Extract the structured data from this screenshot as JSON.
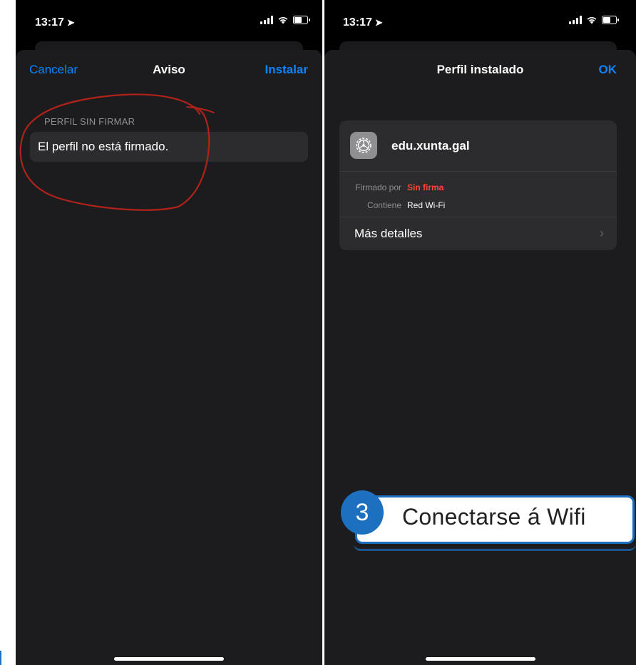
{
  "left_screen": {
    "status": {
      "time": "13:17"
    },
    "nav": {
      "left": "Cancelar",
      "title": "Aviso",
      "right": "Instalar"
    },
    "section_header": "PERFIL SIN FIRMAR",
    "warning_text": "El perfil no está firmado."
  },
  "right_screen": {
    "status": {
      "time": "13:17"
    },
    "nav": {
      "title": "Perfil instalado",
      "right": "OK"
    },
    "profile": {
      "name": "edu.xunta.gal",
      "signed_by_label": "Firmado por",
      "signed_by_value": "Sin firma",
      "contains_label": "Contiene",
      "contains_value": "Red Wi-Fi",
      "details_label": "Más detalles"
    },
    "callout": {
      "number": "3",
      "text": "Conectarse á Wifi"
    }
  },
  "colors": {
    "accent_blue": "#0a84ff",
    "danger_red": "#ff453a",
    "annotation_red": "#b0221a",
    "callout_blue": "#1d6fbf"
  }
}
